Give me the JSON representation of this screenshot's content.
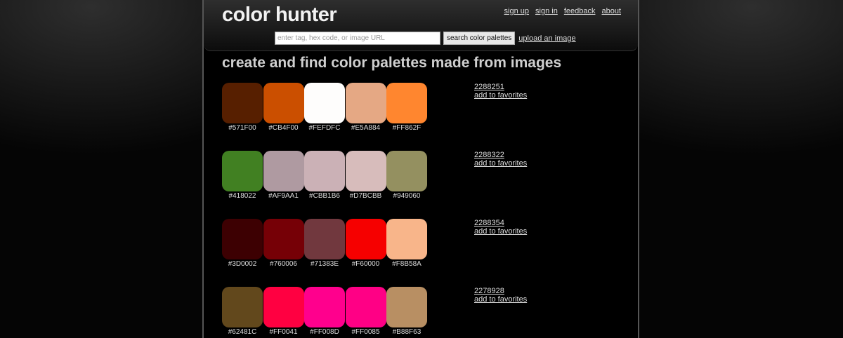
{
  "header": {
    "logo": "color hunter",
    "nav": [
      "sign up",
      "sign in",
      "feedback",
      "about"
    ],
    "search_placeholder": "enter tag, hex code, or image URL",
    "search_button": "search color palettes",
    "upload_link": "upload an image"
  },
  "headline": "create and find color palettes made from images",
  "palettes": [
    {
      "id": "2288251",
      "favorite": "add to favorites",
      "colors": [
        "#571F00",
        "#CB4F00",
        "#FEFDFC",
        "#E5A884",
        "#FF862F"
      ]
    },
    {
      "id": "2288322",
      "favorite": "add to favorites",
      "colors": [
        "#418022",
        "#AF9AA1",
        "#CBB1B6",
        "#D7BCBB",
        "#949060"
      ]
    },
    {
      "id": "2288354",
      "favorite": "add to favorites",
      "colors": [
        "#3D0002",
        "#760006",
        "#71383E",
        "#F60000",
        "#F8B58A"
      ]
    },
    {
      "id": "2278928",
      "favorite": "add to favorites",
      "colors": [
        "#62481C",
        "#FF0041",
        "#FF008D",
        "#FF0085",
        "#B88F63"
      ]
    }
  ]
}
